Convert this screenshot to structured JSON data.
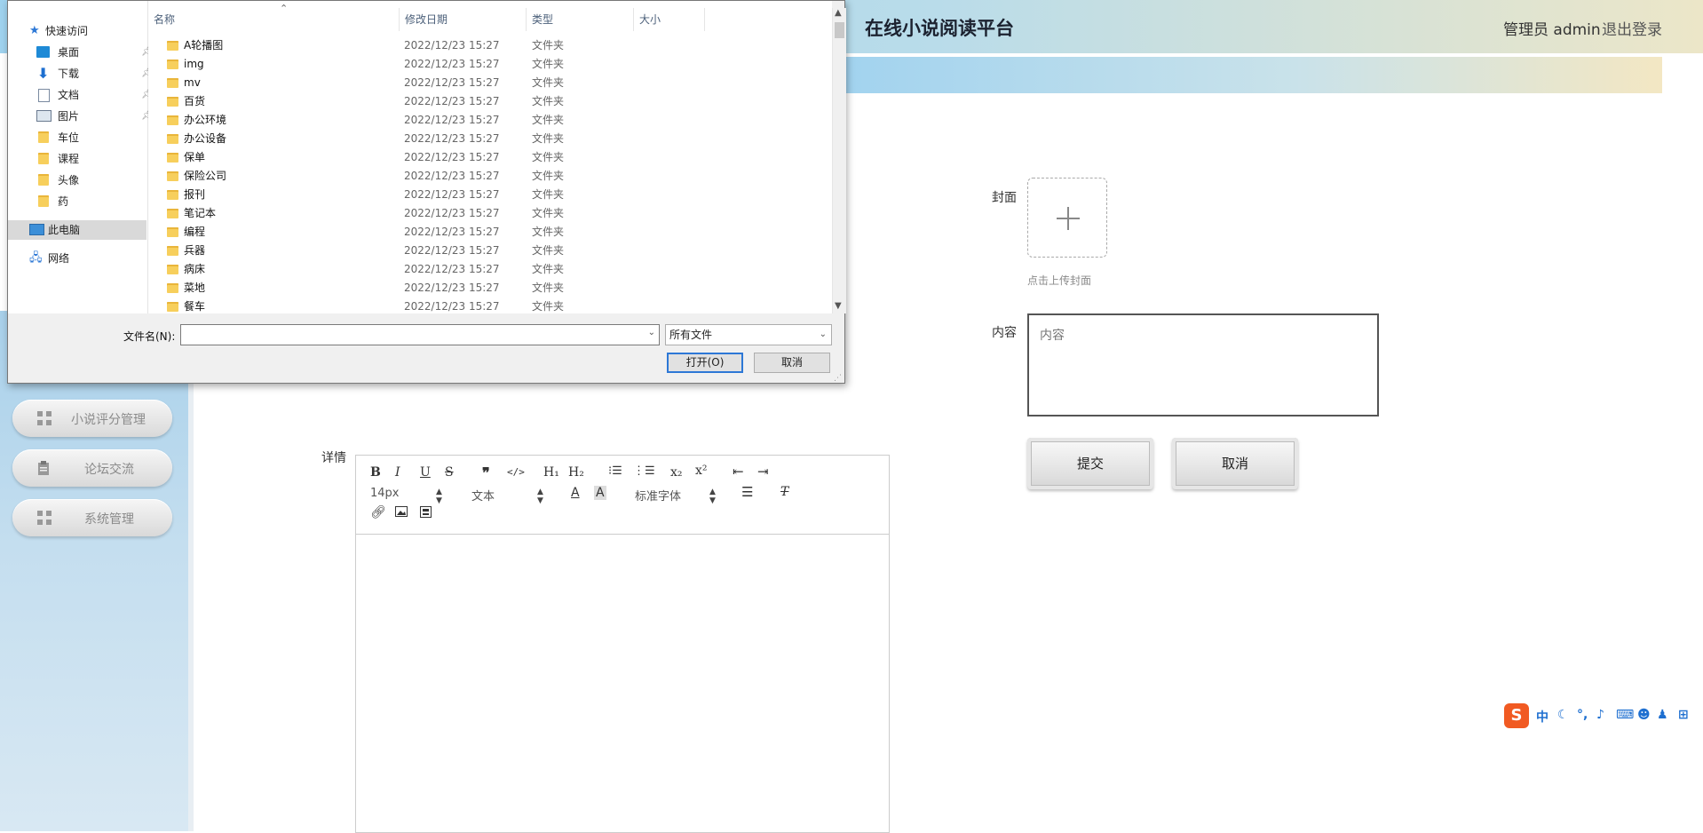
{
  "header": {
    "app_title": "在线小说阅读平台",
    "user_label": "管理员 admin",
    "logout": "退出登录"
  },
  "sidebar": {
    "items": [
      {
        "label": "小说评分管理",
        "icon": "grid-icon"
      },
      {
        "label": "论坛交流",
        "icon": "clipboard-icon"
      },
      {
        "label": "系统管理",
        "icon": "grid-icon"
      }
    ]
  },
  "form": {
    "cover_label": "封面",
    "cover_hint": "点击上传封面",
    "content_label": "内容",
    "content_placeholder": "内容",
    "detail_label": "详情",
    "submit": "提交",
    "cancel": "取消"
  },
  "editor": {
    "font_size": "14px",
    "paragraph": "文本",
    "font_family": "标准字体",
    "icons": [
      "bold-icon",
      "italic-icon",
      "underline-icon",
      "strike-icon",
      "quote-icon",
      "code-icon",
      "h1-icon",
      "h2-icon",
      "ordered-list-icon",
      "bullet-list-icon",
      "subscript-icon",
      "superscript-icon",
      "outdent-icon",
      "indent-icon",
      "font-color-icon",
      "background-color-icon",
      "align-icon",
      "clear-format-icon",
      "link-icon",
      "image-icon",
      "video-icon"
    ]
  },
  "dialog": {
    "nav": {
      "quick_access": "快速访问",
      "pinned": [
        "桌面",
        "下载",
        "文档",
        "图片"
      ],
      "folders": [
        "车位",
        "课程",
        "头像",
        "药"
      ],
      "this_pc": "此电脑",
      "network": "网络"
    },
    "columns": {
      "name": "名称",
      "date": "修改日期",
      "type": "类型",
      "size": "大小"
    },
    "files": [
      {
        "name": "A轮播图",
        "date": "2022/12/23 15:27",
        "type": "文件夹"
      },
      {
        "name": "img",
        "date": "2022/12/23 15:27",
        "type": "文件夹"
      },
      {
        "name": "mv",
        "date": "2022/12/23 15:27",
        "type": "文件夹"
      },
      {
        "name": "百货",
        "date": "2022/12/23 15:27",
        "type": "文件夹"
      },
      {
        "name": "办公环境",
        "date": "2022/12/23 15:27",
        "type": "文件夹"
      },
      {
        "name": "办公设备",
        "date": "2022/12/23 15:27",
        "type": "文件夹"
      },
      {
        "name": "保单",
        "date": "2022/12/23 15:27",
        "type": "文件夹"
      },
      {
        "name": "保险公司",
        "date": "2022/12/23 15:27",
        "type": "文件夹"
      },
      {
        "name": "报刊",
        "date": "2022/12/23 15:27",
        "type": "文件夹"
      },
      {
        "name": "笔记本",
        "date": "2022/12/23 15:27",
        "type": "文件夹"
      },
      {
        "name": "编程",
        "date": "2022/12/23 15:27",
        "type": "文件夹"
      },
      {
        "name": "兵器",
        "date": "2022/12/23 15:27",
        "type": "文件夹"
      },
      {
        "name": "病床",
        "date": "2022/12/23 15:27",
        "type": "文件夹"
      },
      {
        "name": "菜地",
        "date": "2022/12/23 15:27",
        "type": "文件夹"
      },
      {
        "name": "餐车",
        "date": "2022/12/23 15:27",
        "type": "文件夹"
      }
    ],
    "filename_label": "文件名(N):",
    "filename_value": "",
    "filetype": "所有文件",
    "open": "打开(O)",
    "cancel": "取消"
  },
  "ime": {
    "logo": "S",
    "mode": "中"
  },
  "colors": {
    "topbar_start": "#9fd2ee",
    "topbar_end": "#ece6c8",
    "accent": "#2d78d6",
    "folder": "#f7cf5c",
    "ime": "#f15a22"
  }
}
